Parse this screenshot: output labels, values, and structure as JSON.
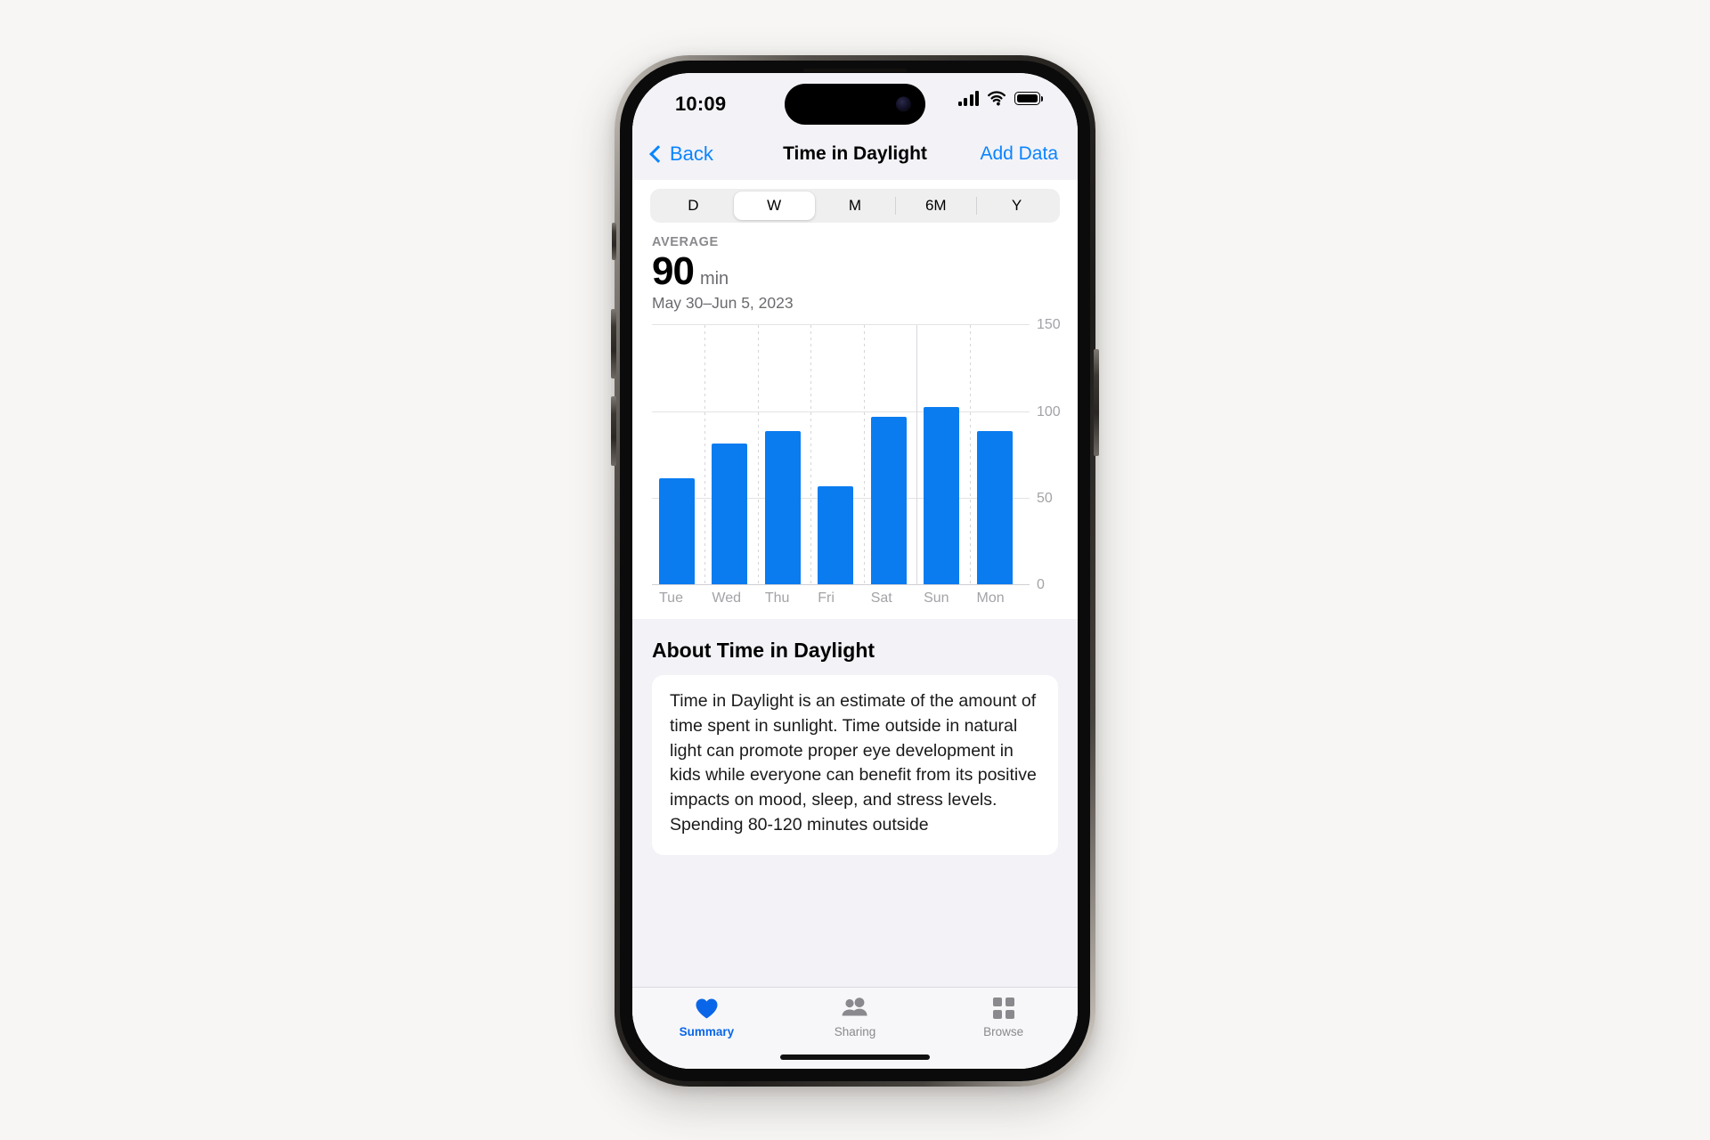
{
  "status_bar": {
    "time": "10:09",
    "cellular_icon": "cellular-signal-icon",
    "wifi_icon": "wifi-icon",
    "battery_icon": "battery-icon"
  },
  "nav_bar": {
    "back_label": "Back",
    "back_icon": "chevron-left-icon",
    "title": "Time in Daylight",
    "action_label": "Add Data"
  },
  "segmented_control": {
    "options": [
      {
        "label": "D",
        "selected": false
      },
      {
        "label": "W",
        "selected": true
      },
      {
        "label": "M",
        "selected": false
      },
      {
        "label": "6M",
        "selected": false
      },
      {
        "label": "Y",
        "selected": false
      }
    ]
  },
  "summary": {
    "label": "AVERAGE",
    "value": "90",
    "unit": "min",
    "date_range": "May 30–Jun 5, 2023"
  },
  "chart_data": {
    "type": "bar",
    "title": "Time in Daylight",
    "categories": [
      "Tue",
      "Wed",
      "Thu",
      "Fri",
      "Sat",
      "Sun",
      "Mon"
    ],
    "values": [
      62,
      82,
      89,
      57,
      97,
      103,
      89
    ],
    "xlabel": "",
    "ylabel": "min",
    "ylim": [
      0,
      150
    ],
    "yticks": [
      0,
      50,
      100,
      150
    ],
    "ytick_labels": [
      "0",
      "50",
      "100",
      "150"
    ],
    "grid": true,
    "legend": "none",
    "bar_color": "#0a7cf0",
    "average": 90
  },
  "about": {
    "heading": "About Time in Daylight",
    "body": "Time in Daylight is an estimate of the amount of time spent in sunlight. Time outside in natural light can promote proper eye development in kids while everyone can benefit from its positive impacts on mood, sleep, and stress levels. Spending 80-120 minutes outside"
  },
  "tab_bar": {
    "tabs": [
      {
        "label": "Summary",
        "icon": "heart-icon",
        "active": true
      },
      {
        "label": "Sharing",
        "icon": "people-icon",
        "active": false
      },
      {
        "label": "Browse",
        "icon": "grid-icon",
        "active": false
      }
    ]
  },
  "colors": {
    "accent": "#0a84ff",
    "bar": "#0a7cf0",
    "tab_active": "#0a66e8"
  }
}
